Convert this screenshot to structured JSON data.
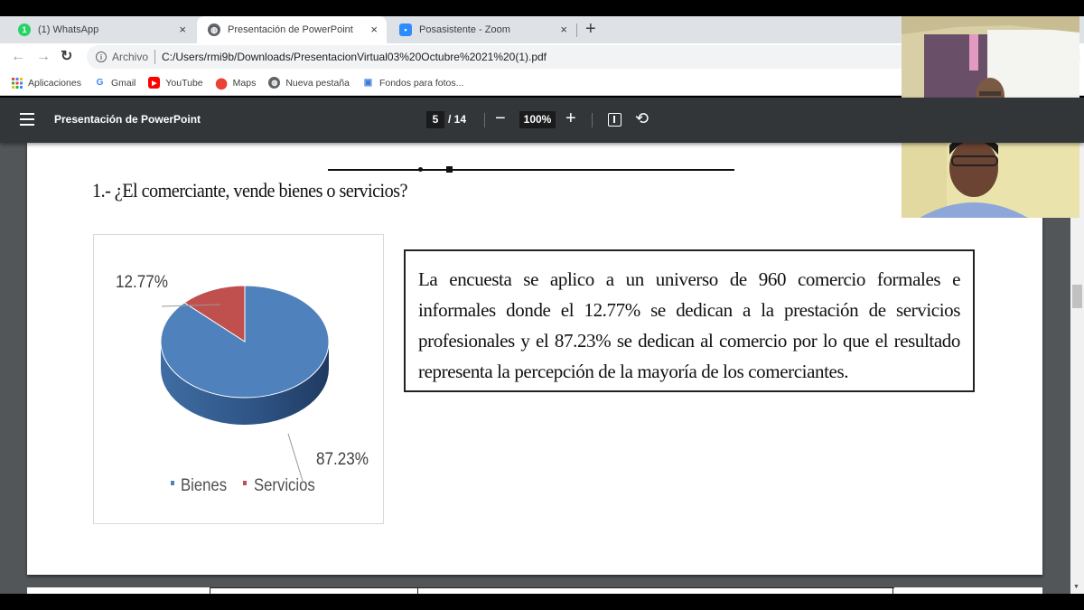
{
  "browser": {
    "tabs": [
      {
        "label": "(1) WhatsApp",
        "icon": "whatsapp-icon",
        "badge": "1",
        "active": false
      },
      {
        "label": "Presentación de PowerPoint",
        "icon": "globe-icon",
        "active": true
      },
      {
        "label": "Posasistente - Zoom",
        "icon": "zoom-icon",
        "active": false
      }
    ],
    "close_glyph": "×",
    "new_tab_glyph": "+",
    "address": {
      "scheme_label": "Archivo",
      "url": "C:/Users/rmi9b/Downloads/PresentacionVirtual03%20Octubre%2021%20(1).pdf"
    },
    "bookmarks": [
      {
        "label": "Aplicaciones",
        "icon": "apps-grid-icon"
      },
      {
        "label": "Gmail",
        "icon": "google-icon"
      },
      {
        "label": "YouTube",
        "icon": "youtube-icon"
      },
      {
        "label": "Maps",
        "icon": "maps-pin-icon"
      },
      {
        "label": "Nueva pestaña",
        "icon": "globe-icon"
      },
      {
        "label": "Fondos para fotos...",
        "icon": "image-icon"
      }
    ]
  },
  "pdf_viewer": {
    "title": "Presentación de PowerPoint",
    "current_page": "5",
    "total_pages": "/ 14",
    "zoom": "100%",
    "zoom_out_glyph": "−",
    "zoom_in_glyph": "+",
    "rotate_glyph": "⟲"
  },
  "document": {
    "question": "1.- ¿El comerciante, vende bienes o servicios?",
    "description": "La encuesta se aplico a un universo de 960 comercio formales e informales donde el 12.77% se dedican a la prestación de servicios profesionales y el 87.23% se dedican al comercio por lo que el resultado representa la percepción de la mayoría de los comerciantes."
  },
  "chart_data": {
    "type": "pie",
    "style": "3d",
    "title": "",
    "categories": [
      "Bienes",
      "Servicios"
    ],
    "values": [
      87.23,
      12.77
    ],
    "labels": [
      "87.23%",
      "12.77%"
    ],
    "colors": [
      "#4f81bd",
      "#c0504d"
    ],
    "legend": {
      "position": "bottom",
      "entries": [
        "Bienes",
        "Servicios"
      ]
    }
  },
  "video_tiles": [
    {
      "participant": "participant-1"
    },
    {
      "participant": "participant-2"
    }
  ]
}
